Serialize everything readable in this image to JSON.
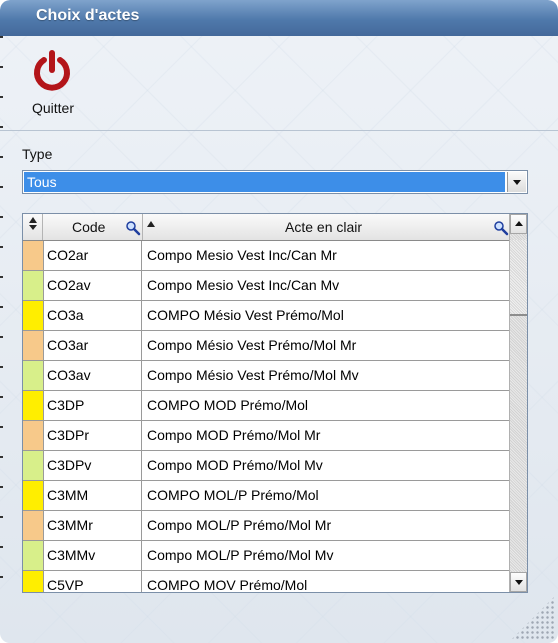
{
  "window": {
    "title": "Choix d'actes"
  },
  "toolbar": {
    "quit_label": "Quitter",
    "quit_icon": "power-icon",
    "quit_color": "#b3151a"
  },
  "filter": {
    "label": "Type",
    "value": "Tous",
    "highlight": "#3d8ee8"
  },
  "table": {
    "headers": {
      "code": "Code",
      "acte": "Acte en clair"
    },
    "rows": [
      {
        "color": "#f7c98a",
        "code": "CO2ar",
        "acte": "Compo Mesio Vest Inc/Can Mr"
      },
      {
        "color": "#d8ef8a",
        "code": "CO2av",
        "acte": "Compo Mesio Vest Inc/Can Mv"
      },
      {
        "color": "#ffee00",
        "code": "CO3a",
        "acte": "COMPO Mésio Vest Prémo/Mol"
      },
      {
        "color": "#f7c98a",
        "code": "CO3ar",
        "acte": "Compo Mésio Vest Prémo/Mol Mr"
      },
      {
        "color": "#d8ef8a",
        "code": "CO3av",
        "acte": "Compo Mésio Vest Prémo/Mol Mv"
      },
      {
        "color": "#ffee00",
        "code": "C3DP",
        "acte": "COMPO MOD Prémo/Mol"
      },
      {
        "color": "#f7c98a",
        "code": "C3DPr",
        "acte": "Compo MOD Prémo/Mol Mr"
      },
      {
        "color": "#d8ef8a",
        "code": "C3DPv",
        "acte": "Compo MOD Prémo/Mol Mv"
      },
      {
        "color": "#ffee00",
        "code": "C3MM",
        "acte": "COMPO MOL/P Prémo/Mol"
      },
      {
        "color": "#f7c98a",
        "code": "C3MMr",
        "acte": "Compo MOL/P Prémo/Mol Mr"
      },
      {
        "color": "#d8ef8a",
        "code": "C3MMv",
        "acte": "Compo MOL/P Prémo/Mol Mv"
      },
      {
        "color": "#ffee00",
        "code": "C5VP",
        "acte": "COMPO MOV Prémo/Mol"
      }
    ]
  }
}
